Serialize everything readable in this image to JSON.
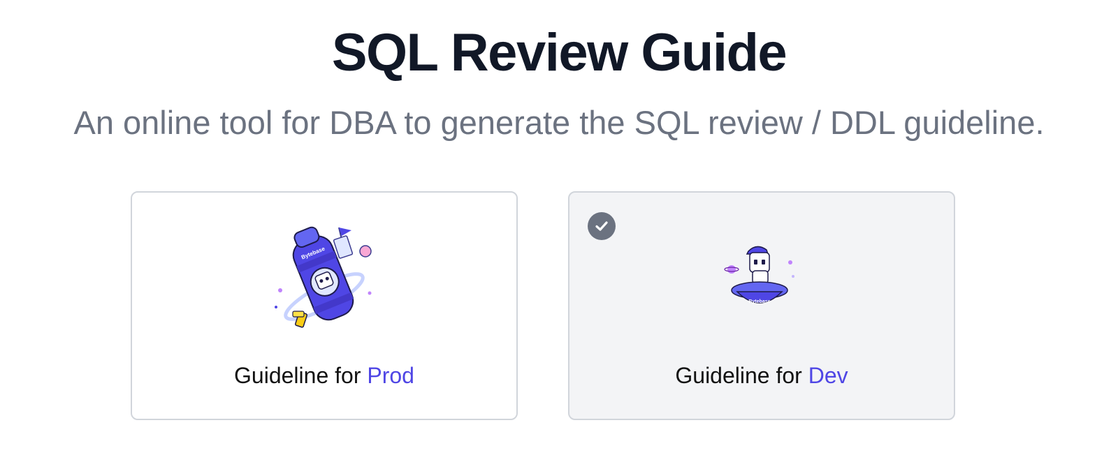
{
  "header": {
    "title": "SQL Review Guide",
    "subtitle": "An online tool for DBA to generate the SQL review / DDL guideline."
  },
  "cards": [
    {
      "label_prefix": "Guideline for ",
      "label_accent": "Prod",
      "selected": false,
      "illustration": "bytebase-rocket-mascot",
      "logo_text": "Bytebase"
    },
    {
      "label_prefix": "Guideline for ",
      "label_accent": "Dev",
      "selected": true,
      "illustration": "bytebase-ufo-mascot",
      "logo_text": "Bytebase"
    }
  ],
  "colors": {
    "title": "#111827",
    "subtitle": "#6b7280",
    "accent": "#4f46e5",
    "card_border": "#d1d5db",
    "selected_bg": "#f3f4f6",
    "check_bg": "#6b7280"
  }
}
